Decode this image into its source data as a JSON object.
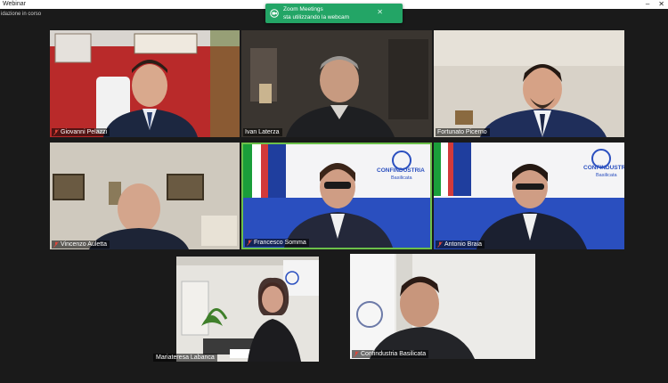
{
  "window": {
    "title": "Webinar",
    "minimize": "–",
    "close": "✕"
  },
  "recording_status": "idazione in corso",
  "notification": {
    "app": "Zoom Meetings",
    "message": "sta utilizzando la webcam",
    "icon": "webcam-icon",
    "close_icon": "close-icon"
  },
  "participants": [
    {
      "name": "Giovanni Pelazzi",
      "muted": true
    },
    {
      "name": "Ivan Laterza",
      "muted": false
    },
    {
      "name": "Fortunato Picerno",
      "muted": false
    },
    {
      "name": "Vincenzo Auletta",
      "muted": true
    },
    {
      "name": "Francesco Somma",
      "muted": true
    },
    {
      "name": "Antonio Braia",
      "muted": true
    },
    {
      "name": "Mariateresa Labanca",
      "muted": false
    },
    {
      "name": "Confindustria Basilicata",
      "muted": true
    }
  ],
  "banner": {
    "org": "CONFINDUSTRIA",
    "region": "Basilicata"
  },
  "colors": {
    "toast": "#23a566",
    "muted_mic": "#e0463b",
    "active_border": "#6cc04a"
  }
}
